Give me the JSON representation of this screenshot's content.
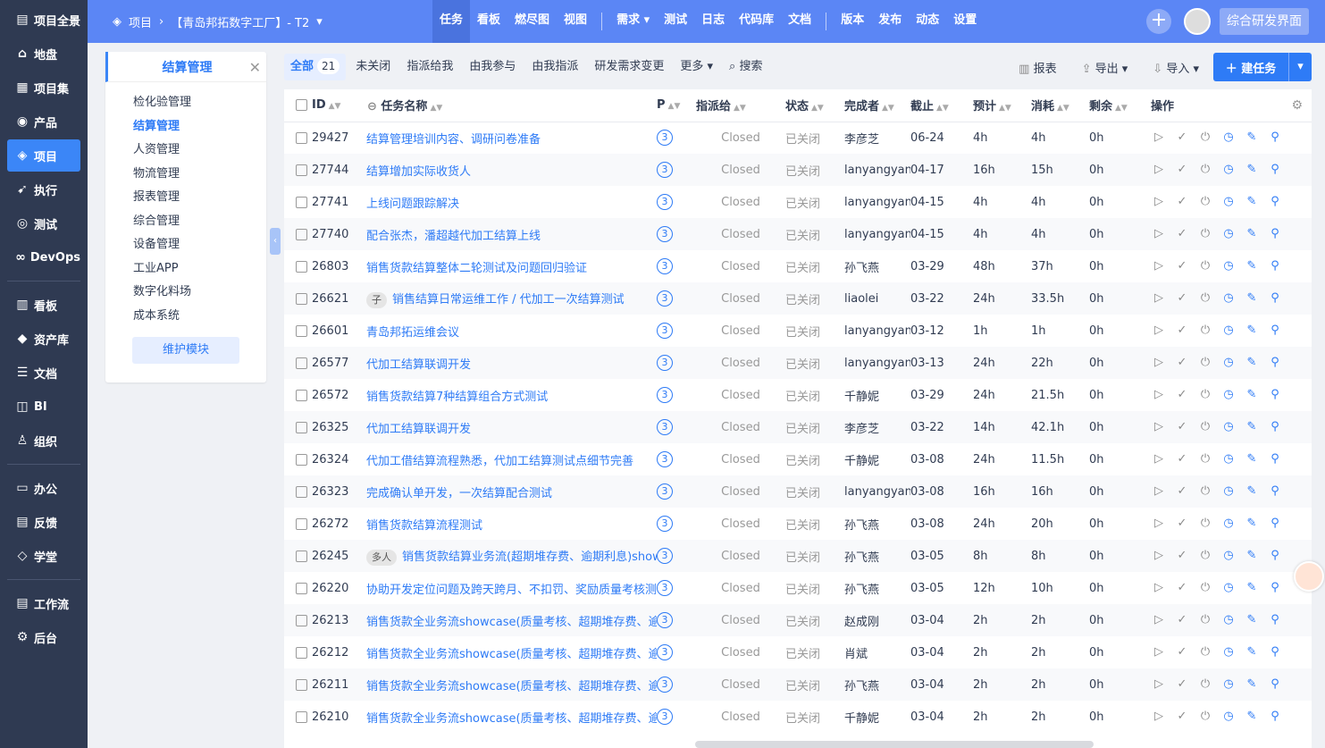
{
  "nav": [
    {
      "icon": "project-overview-icon",
      "glyph": "▤",
      "label": "项目全景"
    },
    {
      "icon": "home-icon",
      "glyph": "⌂",
      "label": "地盘"
    },
    {
      "icon": "project-set-icon",
      "glyph": "▦",
      "label": "项目集"
    },
    {
      "icon": "product-icon",
      "glyph": "◉",
      "label": "产品"
    },
    {
      "icon": "project-icon",
      "glyph": "◈",
      "label": "项目",
      "active": true
    },
    {
      "icon": "execution-icon",
      "glyph": "➹",
      "label": "执行"
    },
    {
      "icon": "test-icon",
      "glyph": "◎",
      "label": "测试"
    },
    {
      "icon": "devops-icon",
      "glyph": "∞",
      "label": "DevOps"
    },
    {
      "sep": true
    },
    {
      "icon": "kanban-icon",
      "glyph": "▥",
      "label": "看板"
    },
    {
      "icon": "asset-library-icon",
      "glyph": "◆",
      "label": "资产库"
    },
    {
      "icon": "doc-icon",
      "glyph": "☰",
      "label": "文档"
    },
    {
      "icon": "bi-icon",
      "glyph": "◫",
      "label": "BI"
    },
    {
      "icon": "org-icon",
      "glyph": "♙",
      "label": "组织"
    },
    {
      "sep": true
    },
    {
      "icon": "office-icon",
      "glyph": "▭",
      "label": "办公"
    },
    {
      "icon": "feedback-icon",
      "glyph": "▤",
      "label": "反馈"
    },
    {
      "icon": "school-icon",
      "glyph": "◇",
      "label": "学堂"
    },
    {
      "sep": true
    },
    {
      "icon": "workflow-icon",
      "glyph": "▤",
      "label": "工作流"
    },
    {
      "icon": "admin-icon",
      "glyph": "⚙",
      "label": "后台"
    }
  ],
  "header": {
    "crumb_root": "项目",
    "project_name": "【青岛邦拓数字工厂】- T2",
    "tabs": [
      {
        "label": "任务",
        "active": true
      },
      {
        "label": "看板"
      },
      {
        "label": "燃尽图"
      },
      {
        "label": "视图"
      },
      {
        "sep": true
      },
      {
        "label": "需求 ▾"
      },
      {
        "label": "测试"
      },
      {
        "label": "日志"
      },
      {
        "label": "代码库"
      },
      {
        "label": "文档"
      },
      {
        "sep": true
      },
      {
        "label": "版本"
      },
      {
        "label": "发布"
      },
      {
        "label": "动态"
      },
      {
        "label": "设置"
      }
    ],
    "ui_switch": "综合研发界面"
  },
  "module": {
    "title": "结算管理",
    "items": [
      {
        "label": "检化验管理"
      },
      {
        "label": "结算管理",
        "active": true
      },
      {
        "label": "人资管理"
      },
      {
        "label": "物流管理"
      },
      {
        "label": "报表管理"
      },
      {
        "label": "综合管理"
      },
      {
        "label": "设备管理"
      },
      {
        "label": "工业APP"
      },
      {
        "label": "数字化料场"
      },
      {
        "label": "成本系统"
      }
    ],
    "maintain_label": "维护模块"
  },
  "toolbar": {
    "filters": [
      {
        "label": "全部",
        "count": "21",
        "active": true
      },
      {
        "label": "未关闭"
      },
      {
        "label": "指派给我"
      },
      {
        "label": "由我参与"
      },
      {
        "label": "由我指派"
      },
      {
        "label": "研发需求变更"
      },
      {
        "label": "更多 ▾"
      },
      {
        "label": "⌕ 搜索"
      }
    ],
    "report": "报表",
    "export": "导出 ▾",
    "import": "导入 ▾",
    "create": "＋ 建任务"
  },
  "table": {
    "columns": [
      "ID",
      "任务名称",
      "P",
      "指派给",
      "状态",
      "完成者",
      "截止",
      "预计",
      "消耗",
      "剩余",
      "操作"
    ],
    "rows": [
      {
        "id": "29427",
        "name": "结算管理培训内容、调研问卷准备",
        "p": "3",
        "assigned": "Closed",
        "status": "已关闭",
        "finisher": "李彦芝",
        "deadline": "06-24",
        "estimate": "4h",
        "consumed": "4h",
        "left": "0h"
      },
      {
        "id": "27744",
        "name": "结算增加实际收货人",
        "p": "3",
        "assigned": "Closed",
        "status": "已关闭",
        "finisher": "lanyangyan",
        "deadline": "04-17",
        "estimate": "16h",
        "consumed": "15h",
        "left": "0h"
      },
      {
        "id": "27741",
        "name": "上线问题跟踪解决",
        "p": "3",
        "assigned": "Closed",
        "status": "已关闭",
        "finisher": "lanyangyan",
        "deadline": "04-15",
        "estimate": "4h",
        "consumed": "4h",
        "left": "0h"
      },
      {
        "id": "27740",
        "name": "配合张杰，潘超越代加工结算上线",
        "p": "3",
        "assigned": "Closed",
        "status": "已关闭",
        "finisher": "lanyangyan",
        "deadline": "04-15",
        "estimate": "4h",
        "consumed": "4h",
        "left": "0h"
      },
      {
        "id": "26803",
        "name": "销售货款结算整体二轮测试及问题回归验证",
        "p": "3",
        "assigned": "Closed",
        "status": "已关闭",
        "finisher": "孙飞燕",
        "deadline": "03-29",
        "estimate": "48h",
        "consumed": "37h",
        "left": "0h"
      },
      {
        "id": "26621",
        "badge": "子",
        "name": "销售结算日常运维工作 / 代加工一次结算测试",
        "p": "3",
        "assigned": "Closed",
        "status": "已关闭",
        "finisher": "liaolei",
        "deadline": "03-22",
        "estimate": "24h",
        "consumed": "33.5h",
        "left": "0h"
      },
      {
        "id": "26601",
        "name": "青岛邦拓运维会议",
        "p": "3",
        "assigned": "Closed",
        "status": "已关闭",
        "finisher": "lanyangyan",
        "deadline": "03-12",
        "estimate": "1h",
        "consumed": "1h",
        "left": "0h"
      },
      {
        "id": "26577",
        "name": "代加工结算联调开发",
        "p": "3",
        "assigned": "Closed",
        "status": "已关闭",
        "finisher": "lanyangyan",
        "deadline": "03-13",
        "estimate": "24h",
        "consumed": "22h",
        "left": "0h"
      },
      {
        "id": "26572",
        "name": "销售货款结算7种结算组合方式测试",
        "p": "3",
        "assigned": "Closed",
        "status": "已关闭",
        "finisher": "千静妮",
        "deadline": "03-29",
        "estimate": "24h",
        "consumed": "21.5h",
        "left": "0h"
      },
      {
        "id": "26325",
        "name": "代加工结算联调开发",
        "p": "3",
        "assigned": "Closed",
        "status": "已关闭",
        "finisher": "李彦芝",
        "deadline": "03-22",
        "estimate": "14h",
        "consumed": "42.1h",
        "left": "0h"
      },
      {
        "id": "26324",
        "name": "代加工借结算流程熟悉，代加工结算测试点细节完善",
        "p": "3",
        "assigned": "Closed",
        "status": "已关闭",
        "finisher": "千静妮",
        "deadline": "03-08",
        "estimate": "24h",
        "consumed": "11.5h",
        "left": "0h"
      },
      {
        "id": "26323",
        "name": "完成确认单开发，一次结算配合测试",
        "p": "3",
        "assigned": "Closed",
        "status": "已关闭",
        "finisher": "lanyangyan",
        "deadline": "03-08",
        "estimate": "16h",
        "consumed": "16h",
        "left": "0h"
      },
      {
        "id": "26272",
        "name": "销售货款结算流程测试",
        "p": "3",
        "assigned": "Closed",
        "status": "已关闭",
        "finisher": "孙飞燕",
        "deadline": "03-08",
        "estimate": "24h",
        "consumed": "20h",
        "left": "0h"
      },
      {
        "id": "26245",
        "badge": "多人",
        "name": "销售货款结算业务流(超期堆存费、逾期利息)show",
        "p": "3",
        "assigned": "Closed",
        "status": "已关闭",
        "finisher": "孙飞燕",
        "deadline": "03-05",
        "estimate": "8h",
        "consumed": "8h",
        "left": "0h"
      },
      {
        "id": "26220",
        "name": "协助开发定位问题及跨天跨月、不扣罚、奖励质量考核测",
        "p": "3",
        "assigned": "Closed",
        "status": "已关闭",
        "finisher": "孙飞燕",
        "deadline": "03-05",
        "estimate": "12h",
        "consumed": "10h",
        "left": "0h"
      },
      {
        "id": "26213",
        "name": "销售货款全业务流showcase(质量考核、超期堆存费、逾",
        "p": "3",
        "assigned": "Closed",
        "status": "已关闭",
        "finisher": "赵成刚",
        "deadline": "03-04",
        "estimate": "2h",
        "consumed": "2h",
        "left": "0h"
      },
      {
        "id": "26212",
        "name": "销售货款全业务流showcase(质量考核、超期堆存费、逾",
        "p": "3",
        "assigned": "Closed",
        "status": "已关闭",
        "finisher": "肖斌",
        "deadline": "03-04",
        "estimate": "2h",
        "consumed": "2h",
        "left": "0h"
      },
      {
        "id": "26211",
        "name": "销售货款全业务流showcase(质量考核、超期堆存费、逾",
        "p": "3",
        "assigned": "Closed",
        "status": "已关闭",
        "finisher": "孙飞燕",
        "deadline": "03-04",
        "estimate": "2h",
        "consumed": "2h",
        "left": "0h"
      },
      {
        "id": "26210",
        "name": "销售货款全业务流showcase(质量考核、超期堆存费、逾",
        "p": "3",
        "assigned": "Closed",
        "status": "已关闭",
        "finisher": "千静妮",
        "deadline": "03-04",
        "estimate": "2h",
        "consumed": "2h",
        "left": "0h"
      }
    ],
    "op_icons": [
      {
        "name": "start-icon",
        "glyph": "▷",
        "color": "g"
      },
      {
        "name": "finish-icon",
        "glyph": "✓",
        "color": "g"
      },
      {
        "name": "close-task-icon",
        "glyph": "⏻",
        "color": "g"
      },
      {
        "name": "record-hours-icon",
        "glyph": "◷",
        "color": "b"
      },
      {
        "name": "edit-icon",
        "glyph": "✎",
        "color": "b"
      },
      {
        "name": "batch-create-icon",
        "glyph": "⚲",
        "color": "b"
      }
    ]
  }
}
